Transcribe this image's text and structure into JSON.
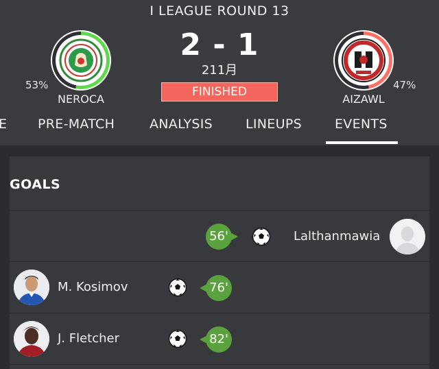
{
  "match": {
    "round": "I LEAGUE ROUND 13",
    "score": "2 - 1",
    "date": "211月",
    "status": "FINISHED",
    "home": {
      "name": "NEROCA",
      "possession": "53%",
      "possession_value": 53,
      "color": "#5fd94a"
    },
    "away": {
      "name": "AIZAWL",
      "possession": "47%",
      "possession_value": 47,
      "color": "#ff6f63"
    }
  },
  "tabs": [
    {
      "label": "E"
    },
    {
      "label": "PRE-MATCH"
    },
    {
      "label": "ANALYSIS"
    },
    {
      "label": "LINEUPS"
    },
    {
      "label": "EVENTS",
      "active": true
    }
  ],
  "goals": {
    "title": "GOALS",
    "events": [
      {
        "minute": "56'",
        "player": "Lalthanmawia",
        "side": "away",
        "icon": "soccer-ball-icon"
      },
      {
        "minute": "76'",
        "player": "M. Kosimov",
        "side": "home",
        "icon": "soccer-ball-icon"
      },
      {
        "minute": "82'",
        "player": "J. Fletcher",
        "side": "home",
        "icon": "soccer-ball-icon"
      }
    ]
  },
  "colors": {
    "accent_green": "#5aa23d",
    "status_red": "#f4665d"
  }
}
